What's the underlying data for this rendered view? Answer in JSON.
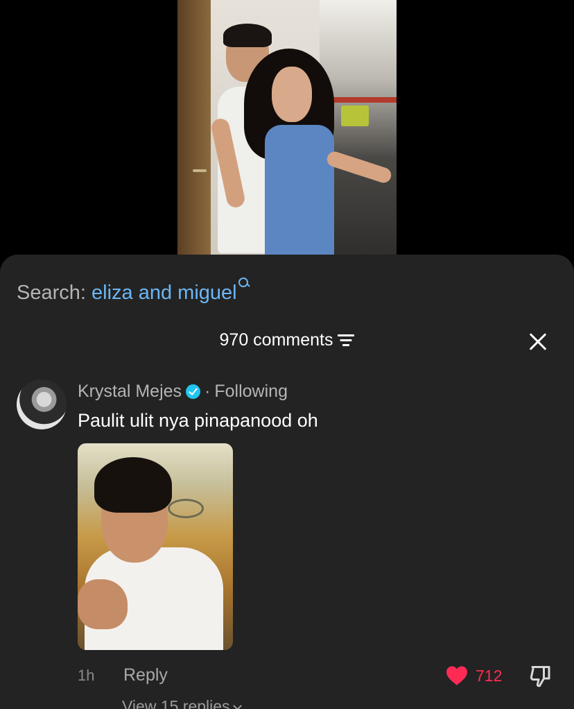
{
  "search": {
    "label": "Search:",
    "query": "eliza and miguel"
  },
  "comments": {
    "count_label": "970 comments"
  },
  "comment": {
    "author": "Krystal Mejes",
    "separator": "·",
    "relationship": "Following",
    "text": "Paulit ulit nya pinapanood oh",
    "time": "1h",
    "reply_label": "Reply",
    "like_count": "712",
    "view_replies_label": "View 15 replies"
  },
  "colors": {
    "sheet_background": "#232323",
    "search_query": "#6cb6f5",
    "like": "#fe2c55",
    "verified_badge": "#20c5f0"
  },
  "icons": [
    "search-icon",
    "sort-icon",
    "close-icon",
    "verified-icon",
    "heart-icon",
    "dislike-icon",
    "chevron-down-icon"
  ]
}
